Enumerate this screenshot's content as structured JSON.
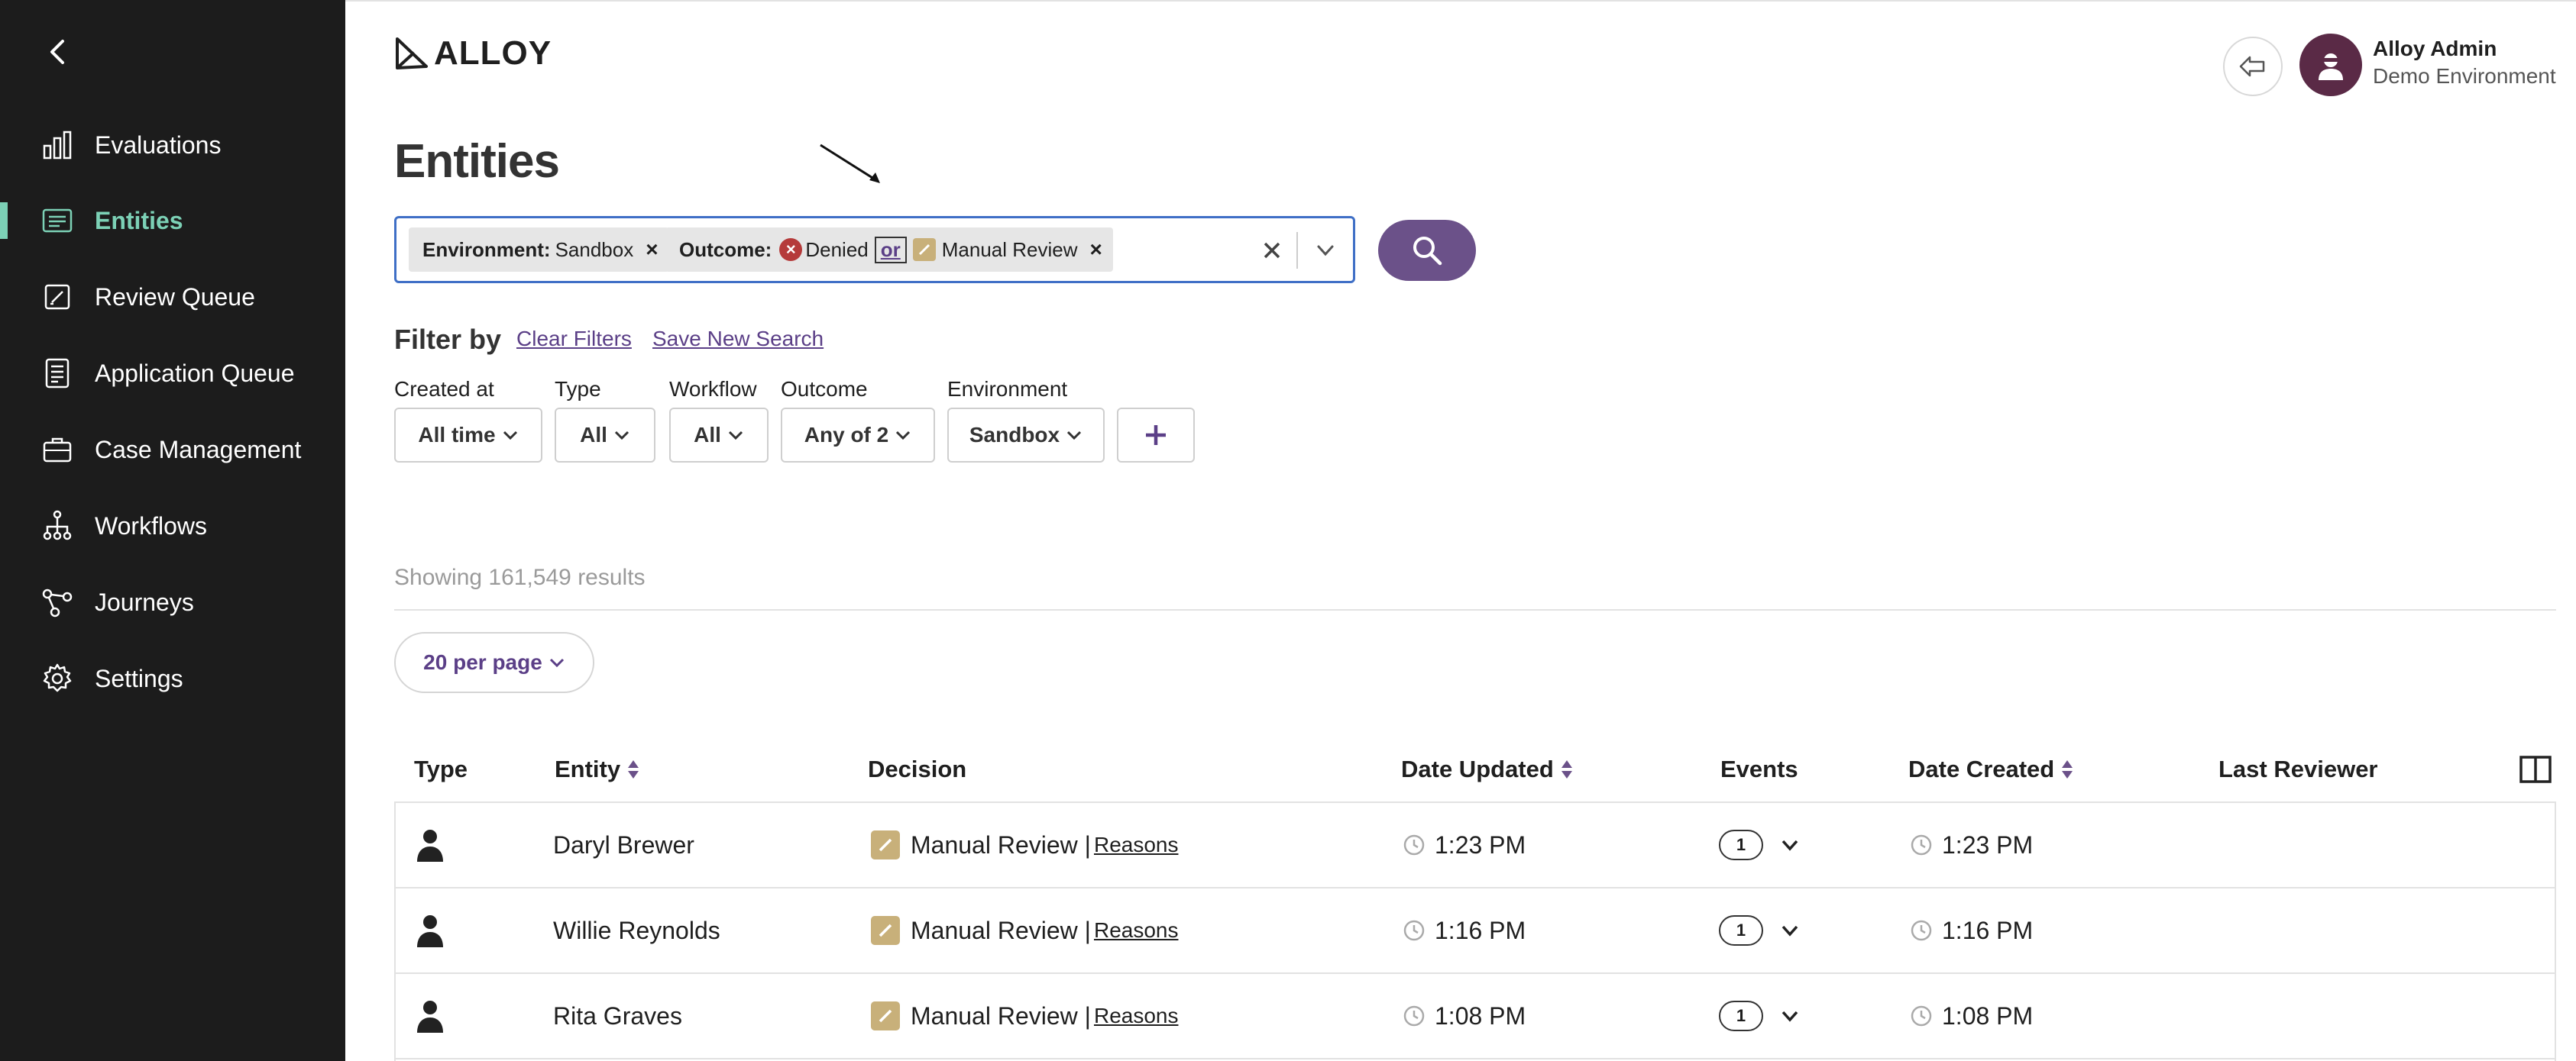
{
  "sidebar": {
    "items": [
      {
        "label": "Evaluations",
        "icon": "bar-chart-icon"
      },
      {
        "label": "Entities",
        "icon": "entities-icon",
        "active": true
      },
      {
        "label": "Review Queue",
        "icon": "edit-square-icon"
      },
      {
        "label": "Application Queue",
        "icon": "document-list-icon"
      },
      {
        "label": "Case Management",
        "icon": "briefcase-icon"
      },
      {
        "label": "Workflows",
        "icon": "workflow-tree-icon"
      },
      {
        "label": "Journeys",
        "icon": "journey-nodes-icon"
      },
      {
        "label": "Settings",
        "icon": "gear-icon"
      }
    ]
  },
  "header": {
    "logo_text": "ALLOY",
    "user_name": "Alloy Admin",
    "user_environment": "Demo Environment"
  },
  "page": {
    "title": "Entities"
  },
  "search": {
    "chips": {
      "environment_key": "Environment:",
      "environment_value": "Sandbox",
      "outcome_key": "Outcome:",
      "outcome_denied": "Denied",
      "or_label": "or",
      "outcome_review": "Manual Review",
      "remove_symbol": "×"
    }
  },
  "filters": {
    "title": "Filter by",
    "clear_label": "Clear Filters",
    "save_label": "Save New Search",
    "created_at": {
      "label": "Created at",
      "value": "All time"
    },
    "type": {
      "label": "Type",
      "value": "All"
    },
    "workflow": {
      "label": "Workflow",
      "value": "All"
    },
    "outcome": {
      "label": "Outcome",
      "value": "Any of 2"
    },
    "environment": {
      "label": "Environment",
      "value": "Sandbox"
    }
  },
  "results": {
    "summary": "Showing 161,549 results",
    "per_page": "20 per page"
  },
  "table": {
    "headers": {
      "type": "Type",
      "entity": "Entity",
      "decision": "Decision",
      "date_updated": "Date Updated",
      "events": "Events",
      "date_created": "Date Created",
      "last_reviewer": "Last Reviewer"
    },
    "rows": [
      {
        "entity": "Daryl Brewer",
        "decision": "Manual Review |",
        "reasons": "Reasons",
        "date_updated": "1:23 PM",
        "events": "1",
        "date_created": "1:23 PM"
      },
      {
        "entity": "Willie Reynolds",
        "decision": "Manual Review |",
        "reasons": "Reasons",
        "date_updated": "1:16 PM",
        "events": "1",
        "date_created": "1:16 PM"
      },
      {
        "entity": "Rita Graves",
        "decision": "Manual Review |",
        "reasons": "Reasons",
        "date_updated": "1:08 PM",
        "events": "1",
        "date_created": "1:08 PM"
      }
    ]
  },
  "colors": {
    "sidebar_bg": "#1c1c1c",
    "active_accent": "#7cd1b6",
    "brand_purple": "#6b5189",
    "denied_red": "#b53a3a",
    "review_tan": "#c8b07a"
  }
}
